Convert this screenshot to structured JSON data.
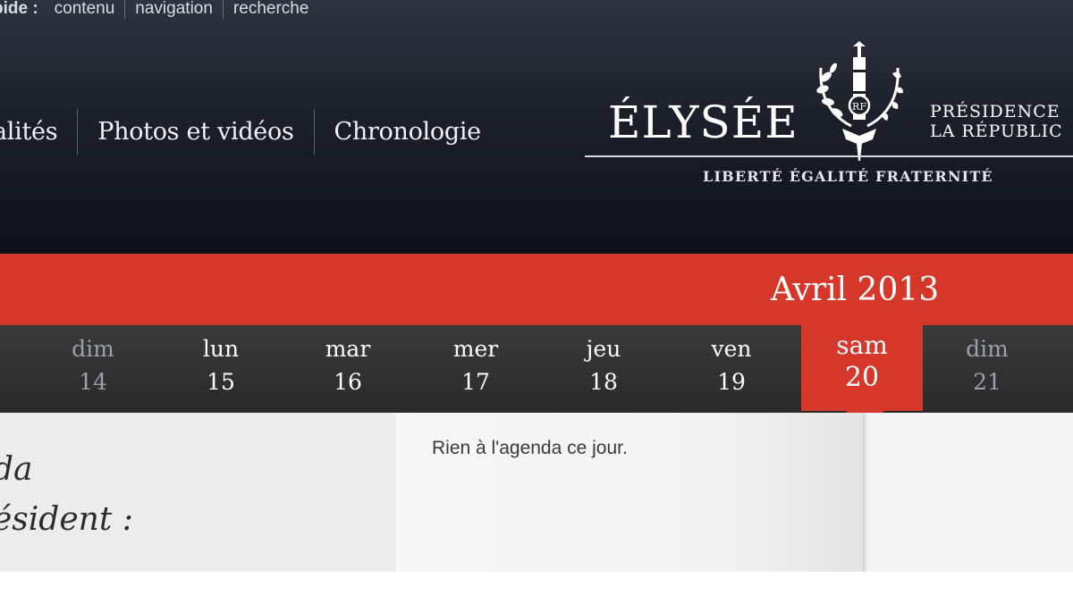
{
  "skip_links": {
    "label": "pide :",
    "items": [
      "contenu",
      "navigation",
      "recherche"
    ]
  },
  "main_nav": {
    "items": [
      "alités",
      "Photos et vidéos",
      "Chronologie"
    ]
  },
  "logo": {
    "word": "ÉLYSÉE",
    "presidency_line1": "PRÉSIDENCE",
    "presidency_line2": "LA RÉPUBLIC",
    "motto": "LIBERTÉ ÉGALITÉ FRATERNITÉ",
    "emblem_icon": "republic-emblem-icon"
  },
  "calendar": {
    "month": "Avril 2013",
    "days": [
      {
        "name": "dim",
        "num": "14",
        "state": "past"
      },
      {
        "name": "lun",
        "num": "15",
        "state": "normal"
      },
      {
        "name": "mar",
        "num": "16",
        "state": "normal"
      },
      {
        "name": "mer",
        "num": "17",
        "state": "normal"
      },
      {
        "name": "jeu",
        "num": "18",
        "state": "normal"
      },
      {
        "name": "ven",
        "num": "19",
        "state": "normal"
      },
      {
        "name": "sam",
        "num": "20",
        "state": "selected"
      },
      {
        "name": "dim",
        "num": "21",
        "state": "past"
      }
    ]
  },
  "agenda": {
    "title_line1": "da",
    "title_line2": "ésident :",
    "empty_message": "Rien à l'agenda ce jour."
  },
  "colors": {
    "header_dark": "#1c202a",
    "accent_red": "#d6372b",
    "strip_dark": "#2a2a2a"
  }
}
